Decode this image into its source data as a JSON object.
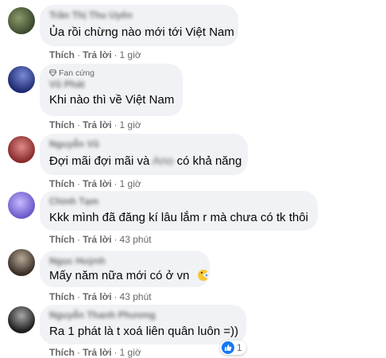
{
  "comments": [
    {
      "author": "Trần Thị Thu Uyên",
      "text": "Ủa rồi chừng nào mới tới Việt Nam",
      "like_label": "Thích",
      "reply_label": "Trả lời",
      "time": "1 giờ",
      "avatar_color": "#5b6b4a"
    },
    {
      "badge": "Fan cứng",
      "author": "Vũ Phát",
      "text": "Khi nào thì về Việt Nam",
      "like_label": "Thích",
      "reply_label": "Trả lời",
      "time": "1 giờ",
      "avatar_color": "#2a3a8a"
    },
    {
      "author": "Nguyễn Vũ",
      "text_before": "Đợi mãi đợi mãi và",
      "text_hidden": "Ano",
      "text_after": "có khả năng",
      "like_label": "Thích",
      "reply_label": "Trả lời",
      "time": "1 giờ",
      "avatar_color": "#c04a4a"
    },
    {
      "author": "Chinh Tạm",
      "text": "Kkk mình đã đăng kí lâu lắm r mà chưa có tk thôi",
      "like_label": "Thích",
      "reply_label": "Trả lời",
      "time": "43 phút",
      "avatar_color": "#8a78d8"
    },
    {
      "author": "Ngọc Huỳnh",
      "text": "Mấy năm nữa mới có ở vn",
      "like_label": "Thích",
      "reply_label": "Trả lời",
      "time": "43 phút",
      "avatar_color": "#4a4038",
      "emoji": "pacman-emoji"
    },
    {
      "author": "Nguyễn Thanh Phương",
      "text": "Ra 1 phát là t xoá liên quân luôn =))",
      "like_label": "Thích",
      "reply_label": "Trả lời",
      "time": "1 giờ",
      "avatar_color": "#3a3a3a",
      "reaction_count": "1",
      "reaction_icon": "like-icon"
    }
  ],
  "separator": "·",
  "colors": {
    "bubble": "#f0f2f5",
    "meta_text": "#65676b",
    "like_blue": "#1877f2"
  }
}
